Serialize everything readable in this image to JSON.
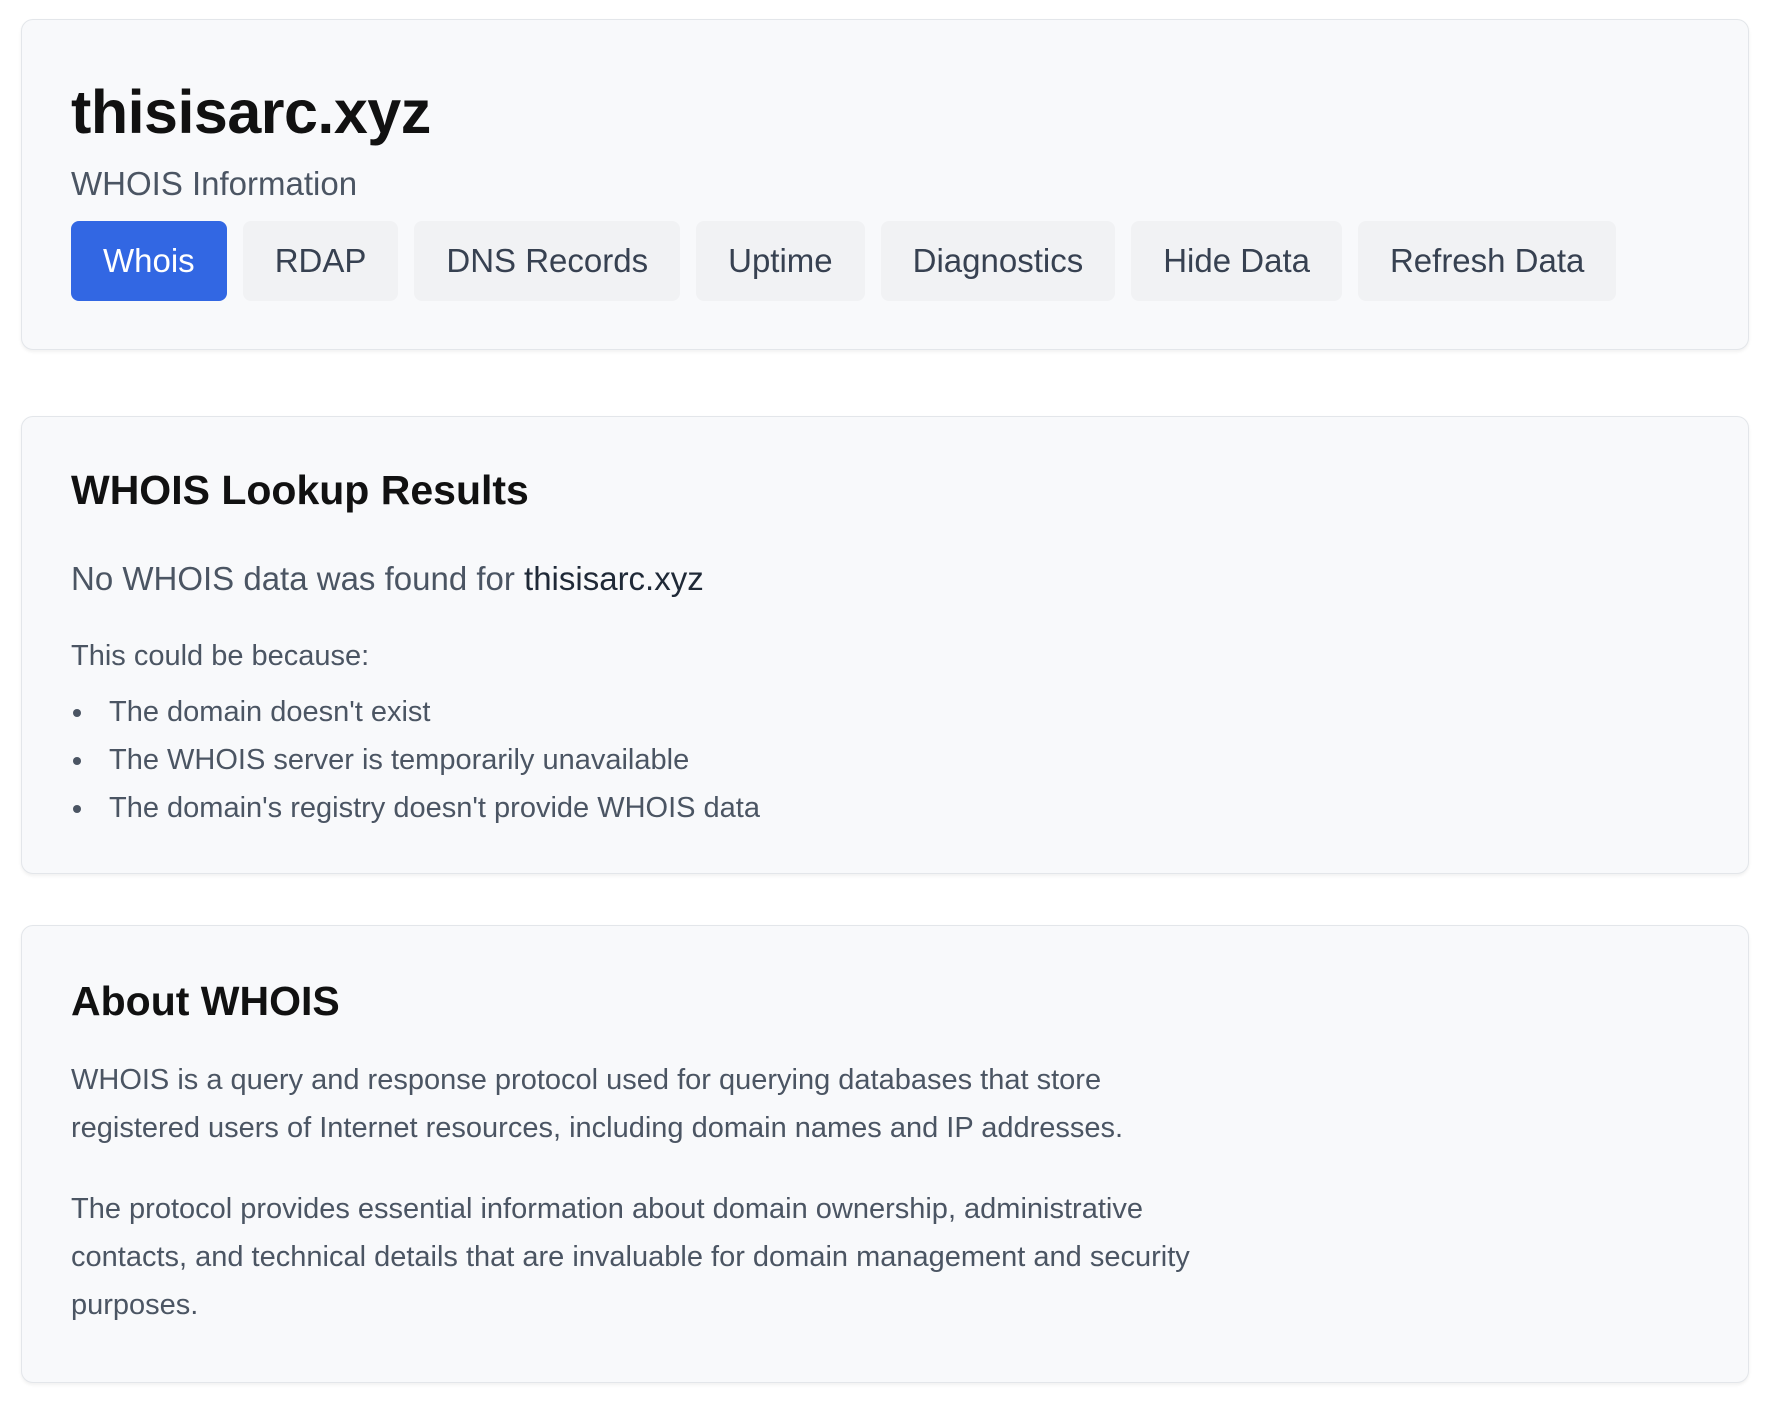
{
  "header": {
    "domain": "thisisarc.xyz",
    "subtitle": "WHOIS Information",
    "tabs": [
      {
        "label": "Whois",
        "active": true
      },
      {
        "label": "RDAP",
        "active": false
      },
      {
        "label": "DNS Records",
        "active": false
      },
      {
        "label": "Uptime",
        "active": false
      },
      {
        "label": "Diagnostics",
        "active": false
      },
      {
        "label": "Hide Data",
        "active": false
      },
      {
        "label": "Refresh Data",
        "active": false
      }
    ]
  },
  "results": {
    "title": "WHOIS Lookup Results",
    "no_data_prefix": "No WHOIS data was found for ",
    "no_data_domain": "thisisarc.xyz",
    "because": "This could be because:",
    "reasons": [
      "The domain doesn't exist",
      "The WHOIS server is temporarily unavailable",
      "The domain's registry doesn't provide WHOIS data"
    ]
  },
  "about": {
    "title": "About WHOIS",
    "paragraph_1": "WHOIS is a query and response protocol used for querying databases that store registered users of Internet resources, including domain names and IP addresses.",
    "paragraph_2": "The protocol provides essential information about domain ownership, administrative contacts, and technical details that are invaluable for domain management and security purposes."
  },
  "colors": {
    "accent": "#3267e3",
    "card_background": "#f8f9fb",
    "tab_background": "#f1f2f4",
    "heading": "#111111",
    "body_text": "#4b5563"
  }
}
